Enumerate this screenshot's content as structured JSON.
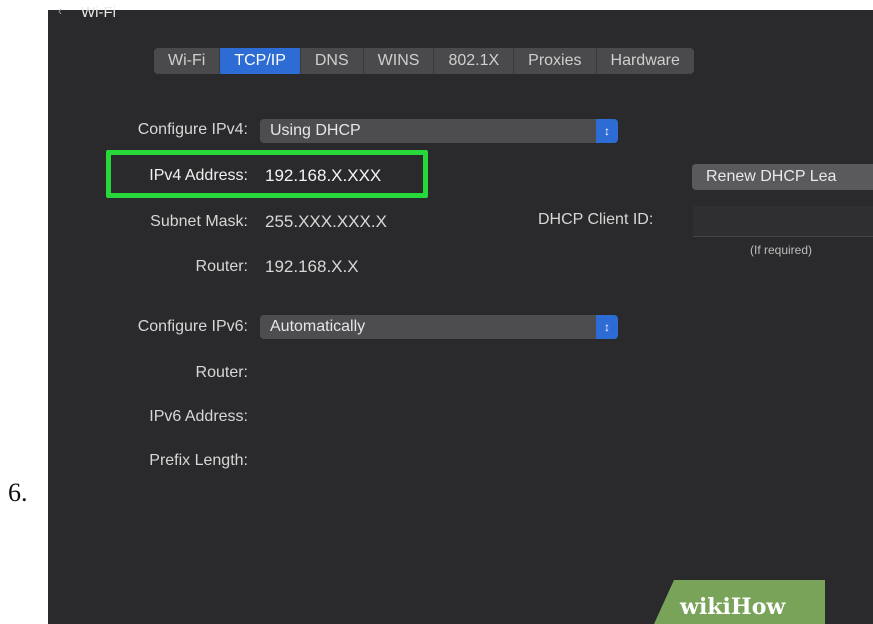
{
  "step_number": "6.",
  "window": {
    "title": "Wi-Fi"
  },
  "tabs": [
    {
      "label": "Wi-Fi",
      "active": false
    },
    {
      "label": "TCP/IP",
      "active": true
    },
    {
      "label": "DNS",
      "active": false
    },
    {
      "label": "WINS",
      "active": false
    },
    {
      "label": "802.1X",
      "active": false
    },
    {
      "label": "Proxies",
      "active": false
    },
    {
      "label": "Hardware",
      "active": false
    }
  ],
  "ipv4": {
    "configure_label": "Configure IPv4:",
    "configure_value": "Using DHCP",
    "address_label": "IPv4 Address:",
    "address_value": "192.168.X.XXX",
    "subnet_label": "Subnet Mask:",
    "subnet_value": "255.XXX.XXX.X",
    "router_label": "Router:",
    "router_value": "192.168.X.X"
  },
  "dhcp": {
    "renew_label": "Renew DHCP Lea",
    "client_id_label": "DHCP Client ID:",
    "client_id_value": "",
    "client_id_hint": "(If required)"
  },
  "ipv6": {
    "configure_label": "Configure IPv6:",
    "configure_value": "Automatically",
    "router_label": "Router:",
    "address_label": "IPv6 Address:",
    "prefix_label": "Prefix Length:"
  },
  "watermark": {
    "wiki": "wiki",
    "how": "How"
  },
  "colors": {
    "panel_bg": "#2a2a2c",
    "active_tab": "#2d6bd5",
    "highlight_box": "#27d83a",
    "watermark_bg": "#7aa35a"
  }
}
